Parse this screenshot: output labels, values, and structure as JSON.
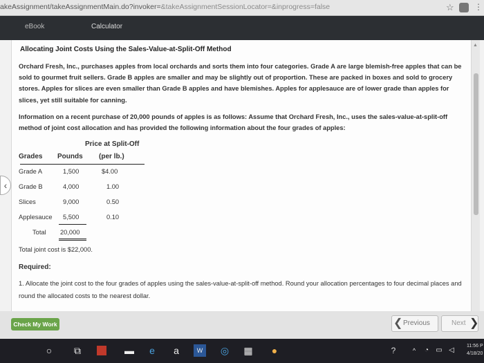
{
  "browser": {
    "url_path": "akeAssignment/takeAssignmentMain.do?invoker=",
    "url_query": "&takeAssignmentSessionLocator=&inprogress=false"
  },
  "tabs": {
    "ebook": "eBook",
    "calculator": "Calculator"
  },
  "problem": {
    "title": "Allocating Joint Costs Using the Sales-Value-at-Split-Off Method",
    "para1": "Orchard Fresh, Inc., purchases apples from local orchards and sorts them into four categories. Grade A are large blemish-free apples that can be sold to gourmet fruit sellers. Grade B apples are smaller and may be slightly out of proportion. These are packed in boxes and sold to grocery stores. Apples for slices are even smaller than Grade B apples and have blemishes. Apples for applesauce are of lower grade than apples for slices, yet still suitable for canning.",
    "para2": "Information on a recent purchase of 20,000 pounds of apples is as follows: Assume that Orchard Fresh, Inc., uses the sales-value-at-split-off method of joint cost allocation and has provided the following information about the four grades of apples:",
    "table": {
      "header_price_line1": "Price at Split-Off",
      "header_grades": "Grades",
      "header_pounds": "Pounds",
      "header_price_line2": "(per lb.)",
      "rows": [
        {
          "grade": "Grade A",
          "pounds": "1,500",
          "price": "$4.00"
        },
        {
          "grade": "Grade B",
          "pounds": "4,000",
          "price": "1.00"
        },
        {
          "grade": "Slices",
          "pounds": "9,000",
          "price": "0.50"
        },
        {
          "grade": "Applesauce",
          "pounds": "5,500",
          "price": "0.10"
        }
      ],
      "total_label": "Total",
      "total_pounds": "20,000"
    },
    "joint_cost": "Total joint cost is $22,000.",
    "required_label": "Required:",
    "required_1": "1. Allocate the joint cost to the four grades of apples using the sales-value-at-split-off method. Round your allocation percentages to four decimal places and round the allocated costs to the nearest dollar."
  },
  "footer": {
    "check": "Check My Work",
    "previous": "Previous",
    "next": "Next"
  },
  "taskbar": {
    "time": "11:56 P",
    "date": "4/18/20"
  }
}
